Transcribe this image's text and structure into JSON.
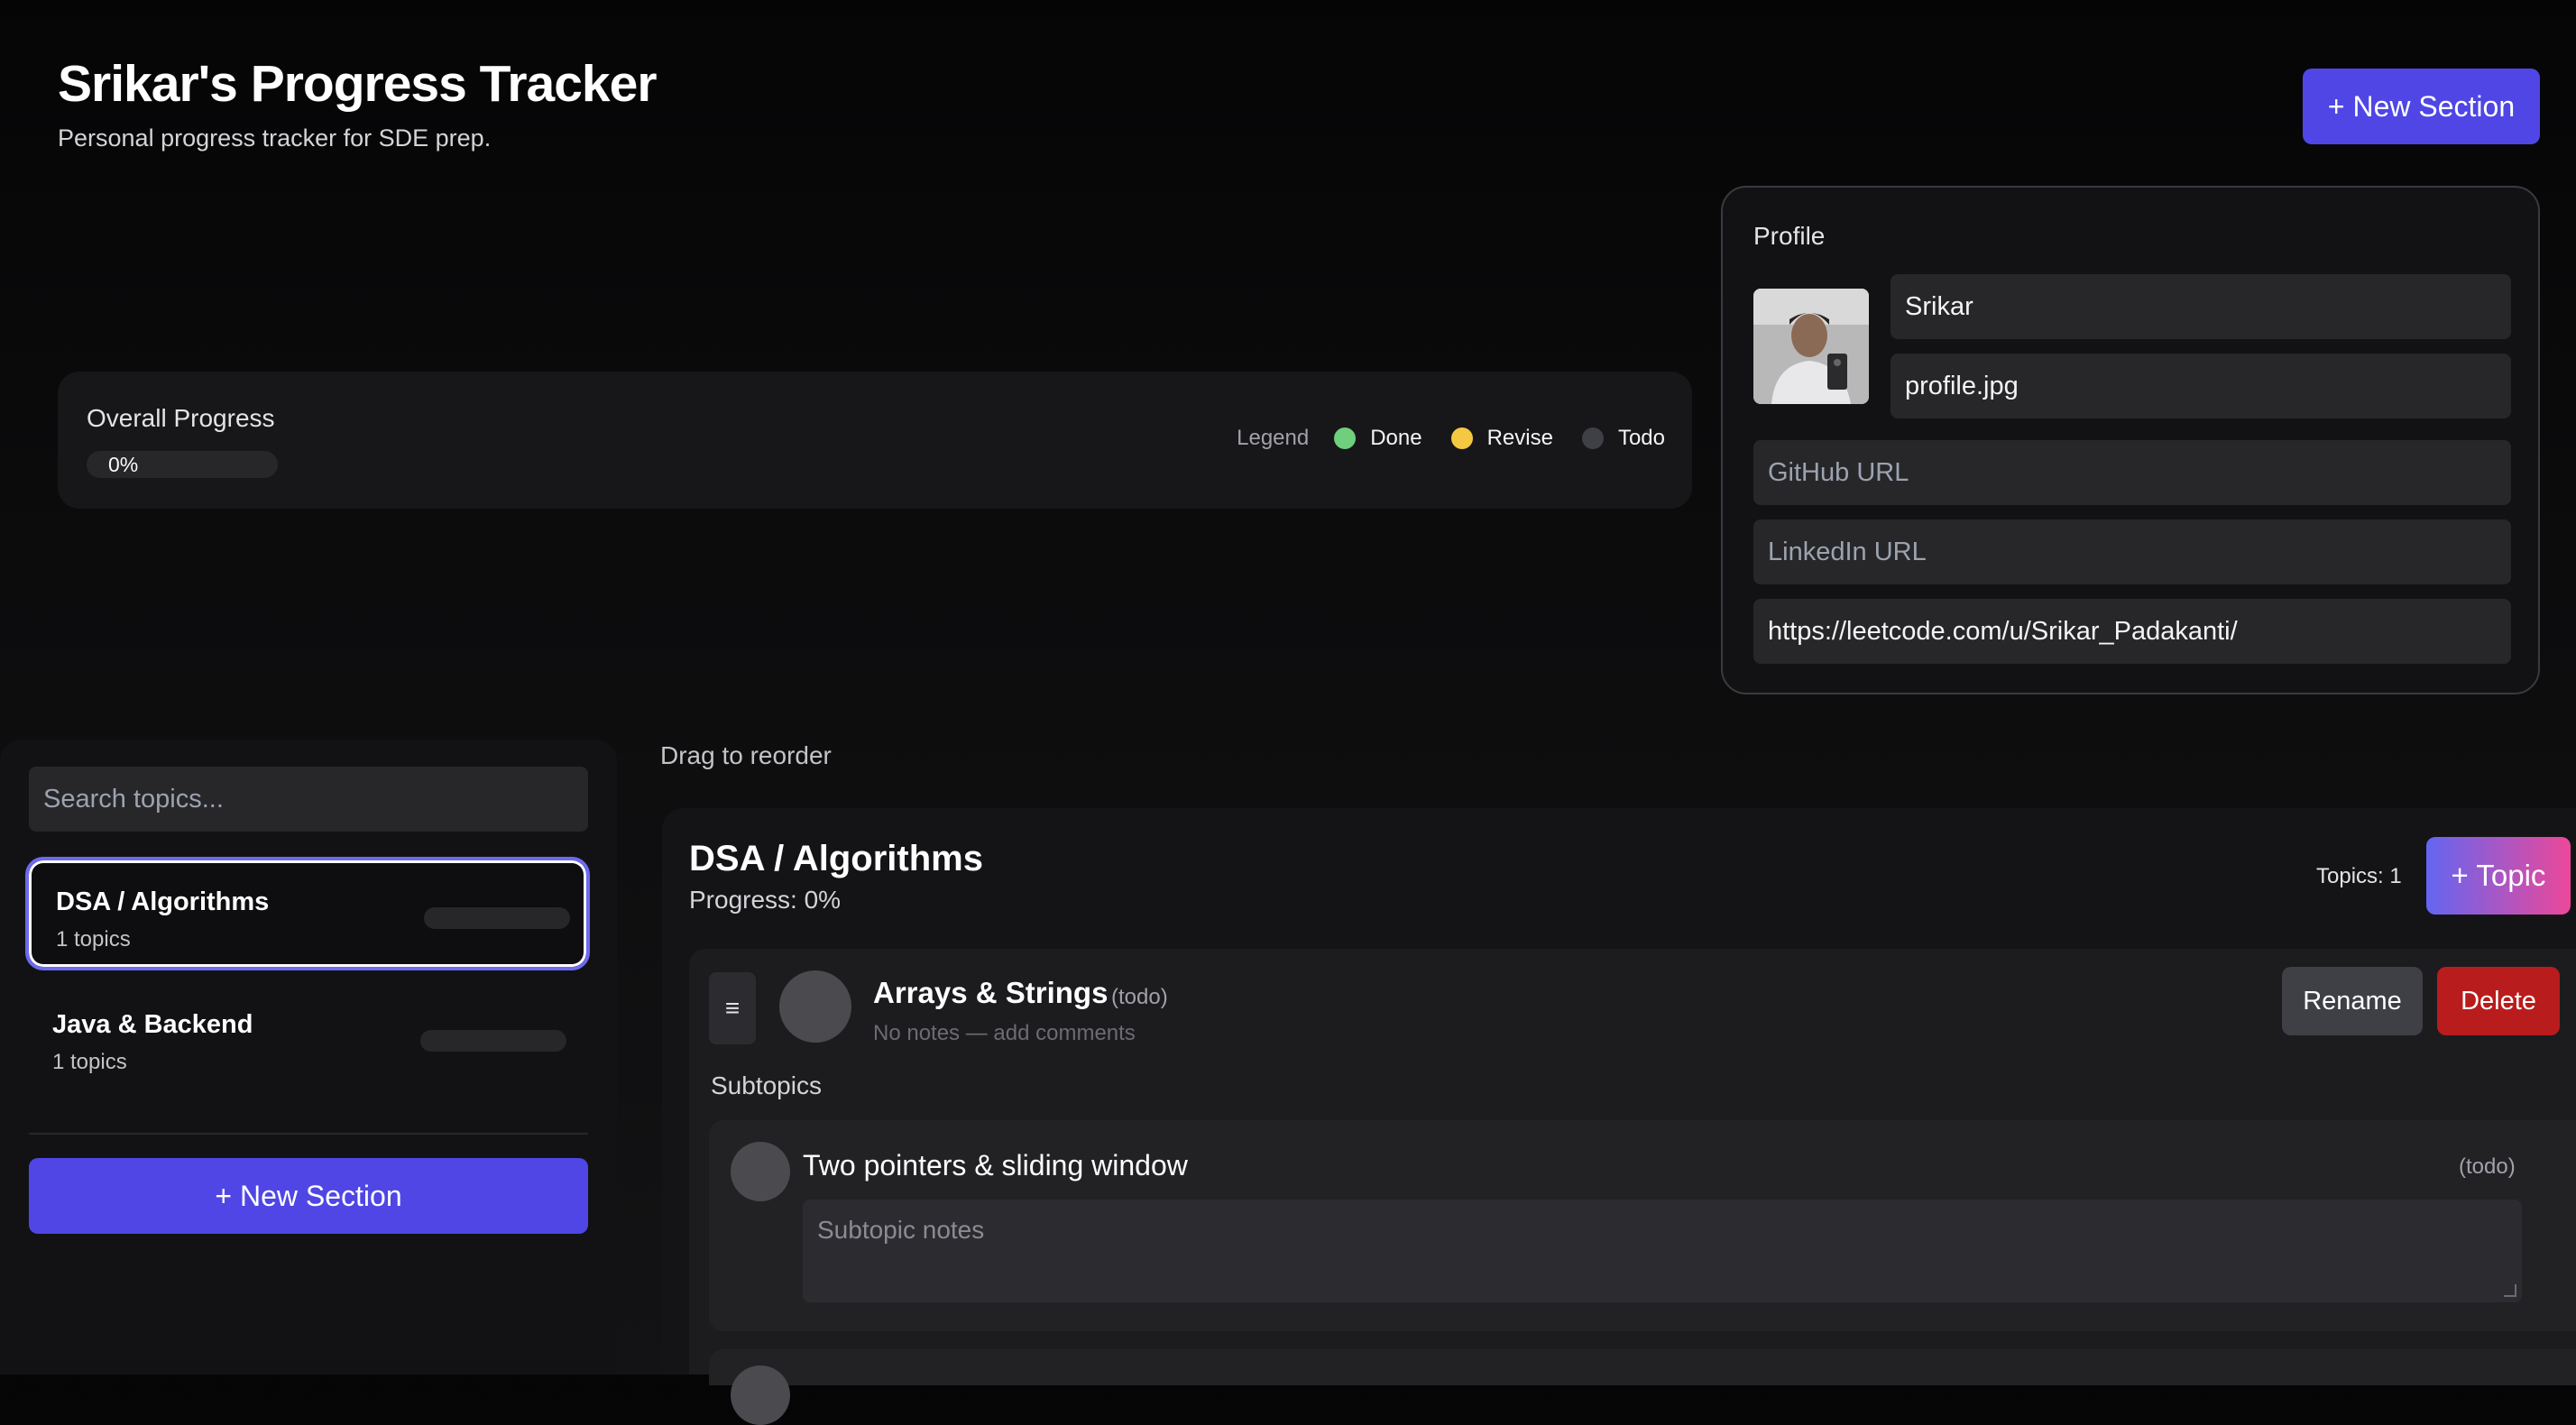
{
  "header": {
    "title": "Srikar's Progress Tracker",
    "subtitle": "Personal progress tracker for SDE prep.",
    "new_section_label": "+ New Section"
  },
  "progress": {
    "label": "Overall Progress",
    "value_text": "0%",
    "value": 0
  },
  "legend": {
    "title": "Legend",
    "items": [
      {
        "label": "Done",
        "color": "#6fcf7c"
      },
      {
        "label": "Revise",
        "color": "#f5c842"
      },
      {
        "label": "Todo",
        "color": "#3f3f46"
      }
    ]
  },
  "profile": {
    "title": "Profile",
    "name": "Srikar",
    "photo": "profile.jpg",
    "github_placeholder": "GitHub URL",
    "linkedin_placeholder": "LinkedIn URL",
    "leetcode": "https://leetcode.com/u/Srikar_Padakanti/"
  },
  "sidebar": {
    "search_placeholder": "Search topics...",
    "sections": [
      {
        "name": "DSA / Algorithms",
        "count": "1 topics",
        "active": true
      },
      {
        "name": "Java & Backend",
        "count": "1 topics",
        "active": false
      }
    ],
    "new_section_label": "+ New Section"
  },
  "main": {
    "drag_hint": "Drag to reorder",
    "section": {
      "title": "DSA / Algorithms",
      "progress": "Progress: 0%",
      "topics_count": "Topics: 1",
      "add_topic_label": "+ Topic"
    },
    "topic": {
      "handle": "≡",
      "name": "Arrays & Strings",
      "status": "(todo)",
      "notes": "No notes — add comments",
      "rename_label": "Rename",
      "delete_label": "Delete",
      "subtopics_label": "Subtopics"
    },
    "subtopic": {
      "name": "Two pointers & sliding window",
      "status": "(todo)",
      "notes_placeholder": "Subtopic notes"
    }
  },
  "colors": {
    "accent": "#4f46e5",
    "danger": "#b91c1c",
    "gradient_start": "#6366f1",
    "gradient_end": "#ec4899"
  }
}
